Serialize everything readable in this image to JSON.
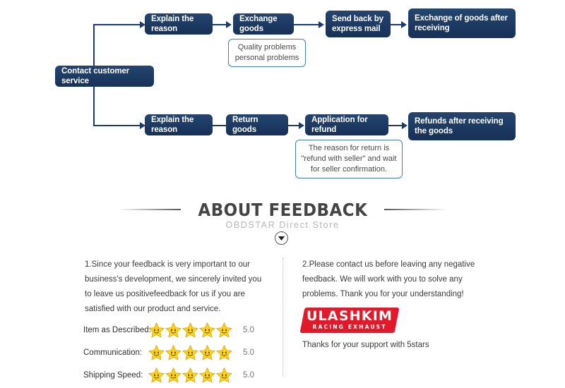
{
  "flowchart": {
    "root": {
      "label": "Contact customer service"
    },
    "branch_exchange": {
      "steps": [
        {
          "label": "Explain the reason"
        },
        {
          "label": "Exchange goods"
        },
        {
          "label": "Send back by express mail"
        },
        {
          "label": "Exchange of goods after receiving"
        }
      ],
      "callout": "Quality problems\npersonal problems"
    },
    "branch_refund": {
      "steps": [
        {
          "label": "Explain the reason"
        },
        {
          "label": "Return goods"
        },
        {
          "label": "Application for refund"
        },
        {
          "label": "Refunds after receiving the goods"
        }
      ],
      "callout": "The reason for return is \"refund with seller\" and wait for seller confirmation."
    },
    "colors": {
      "node_fill": "#1d3b68",
      "node_text": "#ffffff",
      "callout_border": "#3f7ec0",
      "connector": "#1d3b68"
    }
  },
  "about": {
    "title": "ABOUT FEEDBACK",
    "subtitle": "OBDSTAR Direct Store",
    "chevron_icon": "chevron-down-circle-icon"
  },
  "feedback": {
    "paragraph_left": "1.Since your feedback is very important to our business's development, we sincerely invited you to leave us positivefeedback for us if you are satisfied with our product and service.",
    "paragraph_right": "2.Please contact us before leaving any negative feedback. We will work with you to solve any problems. Thank you for your understanding!",
    "ratings": [
      {
        "label": "Item as Described:",
        "stars": 5,
        "score": "5.0"
      },
      {
        "label": "Communication:",
        "stars": 5,
        "score": "5.0"
      },
      {
        "label": "Shipping Speed:",
        "stars": 5,
        "score": "5.0"
      }
    ],
    "logo": {
      "main": "ULASHKIM",
      "sub": "RACING EXHAUST",
      "color": "#e1192a"
    },
    "thanks": "Thanks for your support with 5stars"
  }
}
